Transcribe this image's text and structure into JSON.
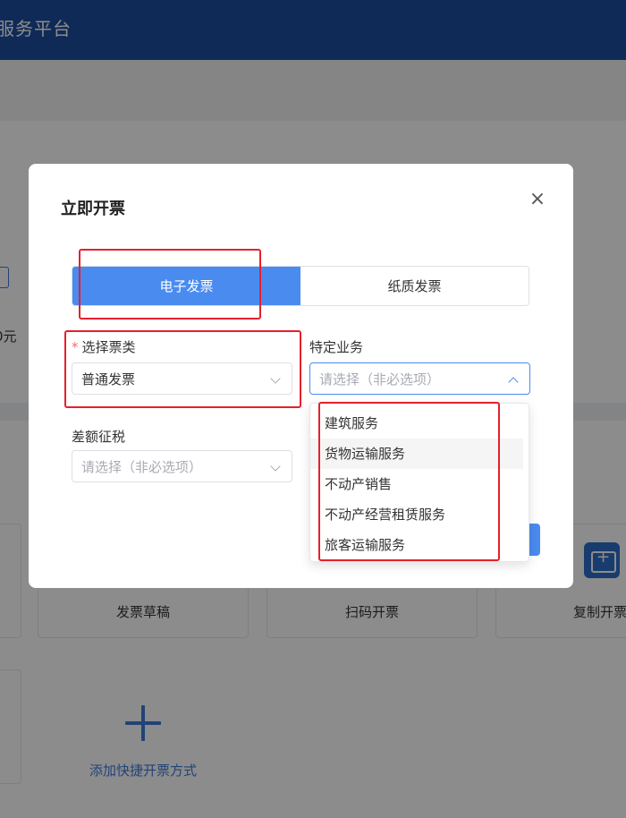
{
  "background": {
    "app_title": "服务平台",
    "edge_text": "0元",
    "cards": [
      {
        "label": "发票草稿"
      },
      {
        "label": "扫码开票"
      },
      {
        "label": "复制开票"
      }
    ],
    "add_shortcut_label": "添加快捷开票方式"
  },
  "modal": {
    "title": "立即开票",
    "close_glyph": "×",
    "tabs": [
      {
        "label": "电子发票",
        "active": true
      },
      {
        "label": "纸质发票",
        "active": false
      }
    ],
    "fields": {
      "ticket_type": {
        "required_mark": "*",
        "label": "选择票类",
        "value": "普通发票"
      },
      "special_business": {
        "label": "特定业务",
        "placeholder": "请选择（非必选项）"
      },
      "differential_tax": {
        "label": "差额征税",
        "placeholder": "请选择（非必选项）"
      }
    },
    "dropdown_options": [
      "建筑服务",
      "货物运输服务",
      "不动产销售",
      "不动产经营租赁服务",
      "旅客运输服务"
    ]
  },
  "colors": {
    "header_bg": "#1d4e9e",
    "primary": "#4a8bf0",
    "annotation_red": "#e5202b"
  }
}
